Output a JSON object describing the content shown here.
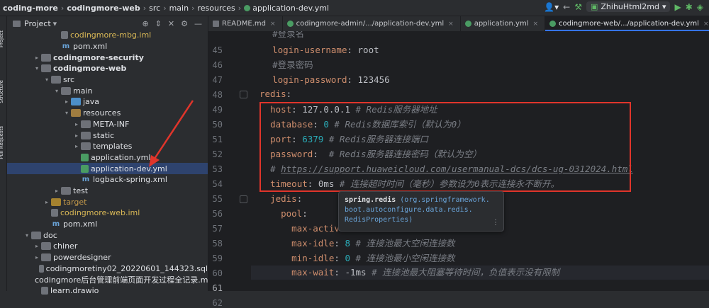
{
  "breadcrumb": [
    "coding-more",
    "codingmore-web",
    "src",
    "main",
    "resources",
    "application-dev.yml"
  ],
  "run_config": "ZhihuHtml2md",
  "side_tools": [
    "Project",
    "Structure",
    "Pull Requests"
  ],
  "project_panel": {
    "title": "Project"
  },
  "tree": [
    {
      "label": "codingmore-mbg.iml",
      "icon": "file-gen",
      "indent": 4,
      "arrow": "",
      "style": "yellow"
    },
    {
      "label": "pom.xml",
      "icon": "file-xml",
      "indent": 4,
      "arrow": "",
      "style": ""
    },
    {
      "label": "codingmore-security",
      "icon": "folder",
      "indent": 2,
      "arrow": "›",
      "style": "bold"
    },
    {
      "label": "codingmore-web",
      "icon": "folder",
      "indent": 2,
      "arrow": "⌄",
      "style": "bold"
    },
    {
      "label": "src",
      "icon": "folder",
      "indent": 3,
      "arrow": "⌄",
      "style": ""
    },
    {
      "label": "main",
      "icon": "folder",
      "indent": 4,
      "arrow": "⌄",
      "style": ""
    },
    {
      "label": "java",
      "icon": "folder src",
      "indent": 5,
      "arrow": "›",
      "style": ""
    },
    {
      "label": "resources",
      "icon": "folder res",
      "indent": 5,
      "arrow": "⌄",
      "style": ""
    },
    {
      "label": "META-INF",
      "icon": "folder",
      "indent": 6,
      "arrow": "›",
      "style": ""
    },
    {
      "label": "static",
      "icon": "folder",
      "indent": 6,
      "arrow": "›",
      "style": ""
    },
    {
      "label": "templates",
      "icon": "folder",
      "indent": 6,
      "arrow": "›",
      "style": ""
    },
    {
      "label": "application.yml",
      "icon": "file-yml",
      "indent": 6,
      "arrow": "",
      "style": ""
    },
    {
      "label": "application-dev.yml",
      "icon": "file-yml",
      "indent": 6,
      "arrow": "",
      "style": "",
      "selected": true
    },
    {
      "label": "logback-spring.xml",
      "icon": "file-xml",
      "indent": 6,
      "arrow": "",
      "style": ""
    },
    {
      "label": "test",
      "icon": "folder",
      "indent": 4,
      "arrow": "›",
      "style": ""
    },
    {
      "label": "target",
      "icon": "folder tgt",
      "indent": 3,
      "arrow": "›",
      "style": "orange"
    },
    {
      "label": "codingmore-web.iml",
      "icon": "file-gen",
      "indent": 3,
      "arrow": "",
      "style": "yellow"
    },
    {
      "label": "pom.xml",
      "icon": "file-xml",
      "indent": 3,
      "arrow": "",
      "style": ""
    },
    {
      "label": "doc",
      "icon": "folder",
      "indent": 1,
      "arrow": "⌄",
      "style": ""
    },
    {
      "label": "chiner",
      "icon": "folder",
      "indent": 2,
      "arrow": "›",
      "style": ""
    },
    {
      "label": "powerdesigner",
      "icon": "folder",
      "indent": 2,
      "arrow": "›",
      "style": ""
    },
    {
      "label": "codingmoretiny02_20220601_144323.sql",
      "icon": "file-gen",
      "indent": 2,
      "arrow": "",
      "style": ""
    },
    {
      "label": "codingmore后台管理前端页面开发过程全记录.md",
      "icon": "file-gen",
      "indent": 2,
      "arrow": "",
      "style": ""
    },
    {
      "label": "learn.drawio",
      "icon": "file-gen",
      "indent": 2,
      "arrow": "",
      "style": ""
    }
  ],
  "tabs": [
    {
      "label": "README.md",
      "icon": "md",
      "active": false
    },
    {
      "label": "codingmore-admin/.../application-dev.yml",
      "icon": "yml",
      "active": false
    },
    {
      "label": "application.yml",
      "icon": "yml",
      "active": false
    },
    {
      "label": "codingmore-web/.../application-dev.yml",
      "icon": "yml",
      "active": true
    }
  ],
  "line_numbers": [
    "45",
    "46",
    "47",
    "48",
    "49",
    "50",
    "51",
    "52",
    "53",
    "54",
    "55",
    "56",
    "57",
    "58",
    "59",
    "60",
    "61",
    "62"
  ],
  "current_line": "61",
  "code": {
    "l44": "#登录名",
    "l45k": "login-username",
    "l45v": "root",
    "l46": "#登录密码",
    "l47k": "login-password",
    "l47v": "123456",
    "l48k": "redis",
    "l49k": "host",
    "l49v": "127.0.0.1",
    "l49c": "# Redis服务器地址",
    "l50k": "database",
    "l50v": "0",
    "l50c": "# Redis数据库索引（默认为0）",
    "l51k": "port",
    "l51v": "6379",
    "l51c": "# Redis服务器连接端口",
    "l52k": "password",
    "l52c": "# Redis服务器连接密码（默认为空）",
    "l53hash": "#",
    "l53url": "https://support.huaweicloud.com/usermanual-dcs/dcs-ug-0312024.html",
    "l54k": "timeout",
    "l54v": "0ms",
    "l54c": "# 连接超时时间（毫秒）参数设为0表示连接永不断开。",
    "l55k": "jedis",
    "l56k": "pool",
    "l57k": "max-activ",
    "l58k": "max-idle",
    "l58v": "8",
    "l58c": "# 连接池最大空闲连接数",
    "l59k": "min-idle",
    "l59v": "0",
    "l59c": "# 连接池最小空闲连接数",
    "l60k": "max-wait",
    "l60v": "-1ms",
    "l60c": "# 连接池最大阻塞等待时间，负值表示没有限制"
  },
  "tooltip": {
    "line1_bold": "spring.redis",
    "line1_pkg": "(org.springframework.",
    "line2": "boot.autoconfigure.data.redis.",
    "line3": "RedisProperties)"
  }
}
